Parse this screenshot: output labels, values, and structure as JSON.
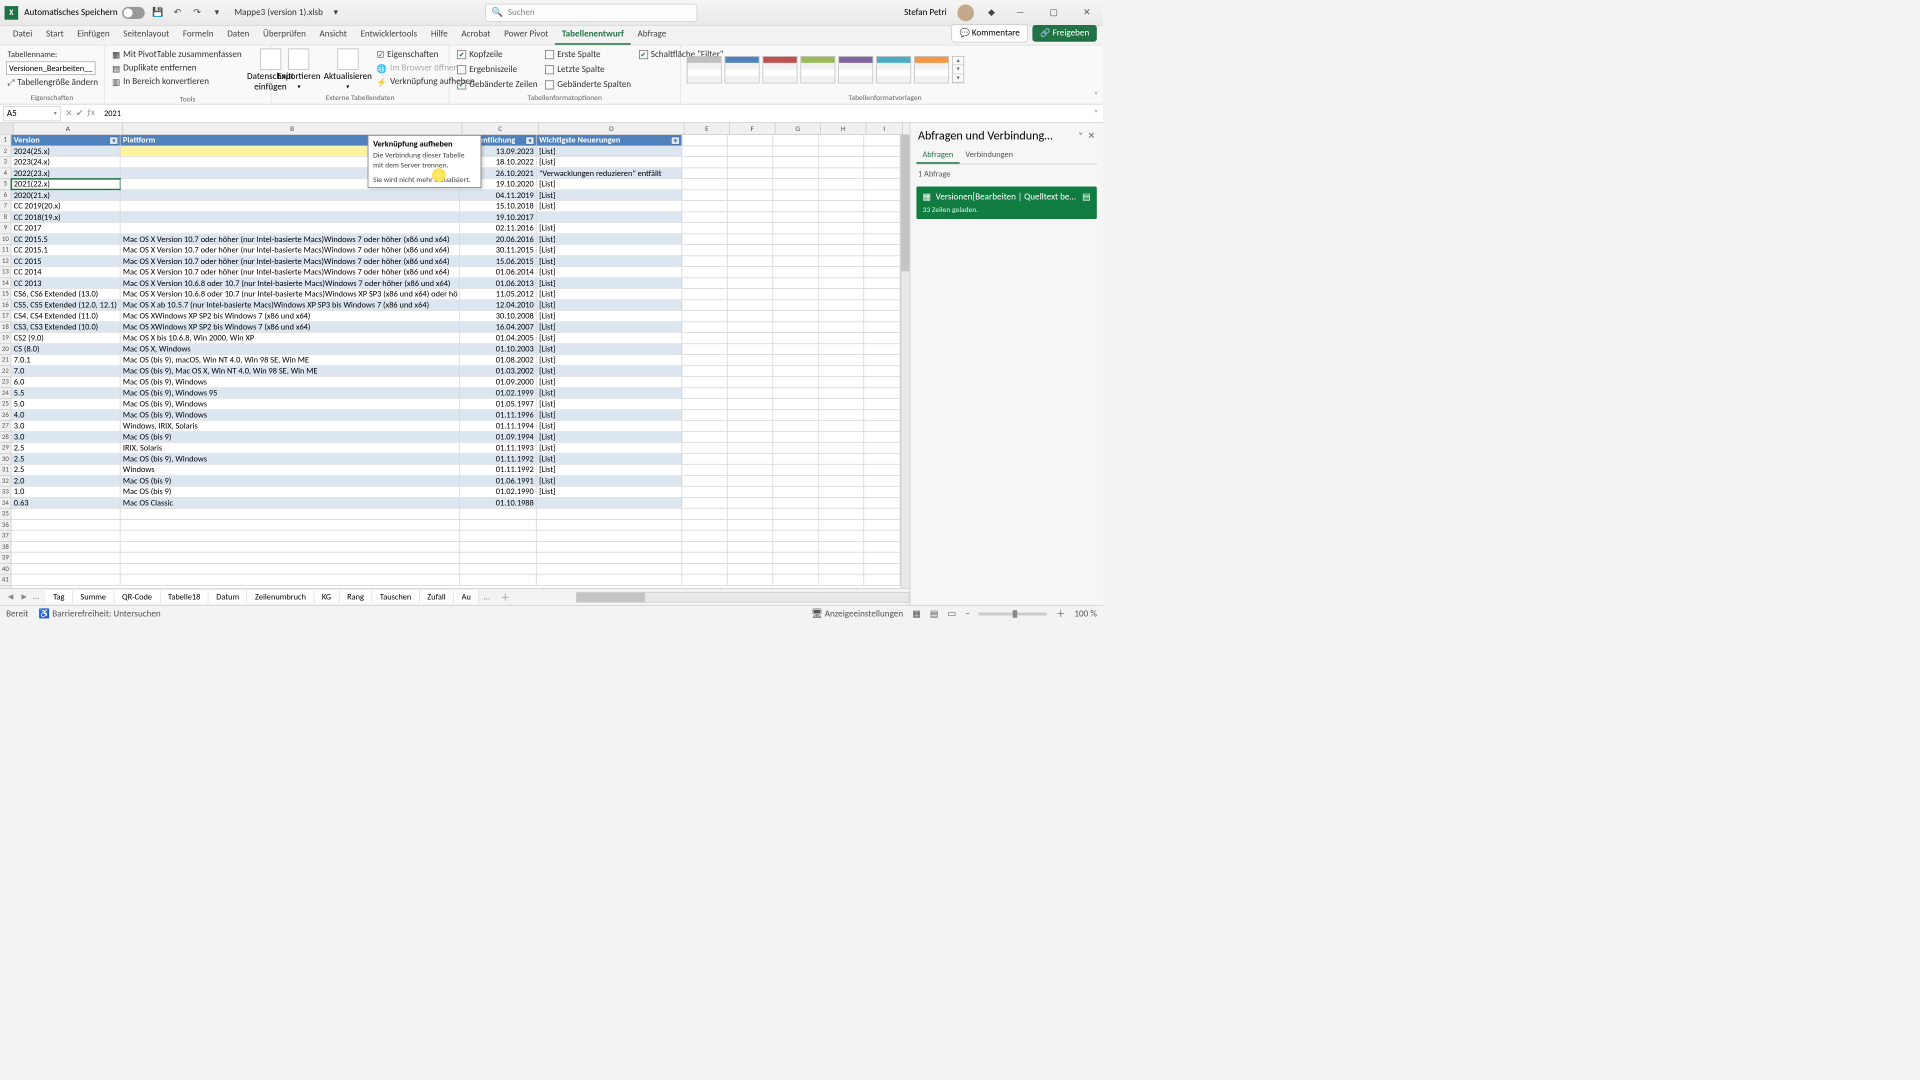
{
  "titlebar": {
    "autosave": "Automatisches Speichern",
    "filename": "Mappe3 (version 1).xlsb",
    "search_ph": "Suchen",
    "user": "Stefan Petri"
  },
  "tabs": [
    "Datei",
    "Start",
    "Einfügen",
    "Seitenlayout",
    "Formeln",
    "Daten",
    "Überprüfen",
    "Ansicht",
    "Entwicklertools",
    "Hilfe",
    "Acrobat",
    "Power Pivot",
    "Tabellenentwurf",
    "Abfrage"
  ],
  "tabs_active": 12,
  "ribbon": {
    "comments": "Kommentare",
    "share": "Freigeben",
    "g_props": {
      "label": "Eigenschaften",
      "name": "Tabellenname:",
      "value": "Versionen_Bearbeiten__Qu",
      "resize": "Tabellengröße ändern"
    },
    "g_tools": {
      "label": "Tools",
      "pivot": "Mit PivotTable zusammenfassen",
      "dup": "Duplikate entfernen",
      "range": "In Bereich konvertieren",
      "slicer": "Datenschnitt\neinfügen"
    },
    "g_ext": {
      "label": "Externe Tabellendaten",
      "export": "Exportieren",
      "refresh": "Aktualisieren",
      "props": "Eigenschaften",
      "browser": "Im Browser öffnen",
      "unlink": "Verknüpfung aufheben"
    },
    "g_opts": {
      "label": "Tabellenformatoptionen",
      "header": "Kopfzeile",
      "total": "Ergebniszeile",
      "banded_r": "Gebänderte Zeilen",
      "first": "Erste Spalte",
      "last": "Letzte Spalte",
      "banded_c": "Gebänderte Spalten",
      "filter": "Schaltfläche \"Filter\""
    },
    "g_styles": {
      "label": "Tabellenformatvorlagen"
    }
  },
  "tooltip": {
    "title": "Verknüpfung aufheben",
    "body": "Die Verbindung dieser Tabelle mit dem Server trennen.",
    "foot": "Sie wird nicht mehr aktualisiert."
  },
  "namebox": "A5",
  "formula": "2021",
  "col_letters": [
    "A",
    "B",
    "C",
    "D",
    "E",
    "F",
    "G",
    "H",
    "I"
  ],
  "headers": {
    "A": "Version",
    "B": "Plattform",
    "C": "eröffentlichung",
    "D": "Wichtigste Neuerungen"
  },
  "rows": [
    {
      "A": "2024(25.x)",
      "B": "",
      "C": "13.09.2023",
      "D": "[List]"
    },
    {
      "A": "2023(24.x)",
      "B": "",
      "C": "18.10.2022",
      "D": "[List]"
    },
    {
      "A": "2022(23.x)",
      "B": "",
      "C": "26.10.2021",
      "D": "\"Verwacklungen reduzieren\" entfällt"
    },
    {
      "A": "2021(22.x)",
      "B": "",
      "C": "19.10.2020",
      "D": "[List]"
    },
    {
      "A": "2020(21.x)",
      "B": "",
      "C": "04.11.2019",
      "D": "[List]"
    },
    {
      "A": "CC 2019(20.x)",
      "B": "",
      "C": "15.10.2018",
      "D": "[List]"
    },
    {
      "A": "CC 2018(19.x)",
      "B": "",
      "C": "19.10.2017",
      "D": ""
    },
    {
      "A": "CC 2017",
      "B": "",
      "C": "02.11.2016",
      "D": "[List]"
    },
    {
      "A": "CC 2015.5",
      "B": "Mac OS X Version 10.7 oder höher (nur Intel-basierte Macs)Windows 7 oder höher (x86 und x64)",
      "C": "20.06.2016",
      "D": "[List]"
    },
    {
      "A": "CC 2015.1",
      "B": "Mac OS X Version 10.7 oder höher (nur Intel-basierte Macs)Windows 7 oder höher (x86 und x64)",
      "C": "30.11.2015",
      "D": "[List]"
    },
    {
      "A": "CC 2015",
      "B": "Mac OS X Version 10.7 oder höher (nur Intel-basierte Macs)Windows 7 oder höher (x86 und x64)",
      "C": "15.06.2015",
      "D": "[List]"
    },
    {
      "A": "CC 2014",
      "B": "Mac OS X Version 10.7 oder höher (nur Intel-basierte Macs)Windows 7 oder höher (x86 und x64)",
      "C": "01.06.2014",
      "D": "[List]"
    },
    {
      "A": "CC 2013",
      "B": "Mac OS X Version 10.6.8 oder 10.7 (nur Intel-basierte Macs)Windows 7 oder höher (x86 und x64)",
      "C": "01.06.2013",
      "D": "[List]"
    },
    {
      "A": "CS6, CS6 Extended (13.0)",
      "B": "Mac OS X Version 10.6.8 oder 10.7 (nur Intel-basierte Macs)Windows XP SP3 (x86 und x64) oder hö",
      "C": "11.05.2012",
      "D": "[List]"
    },
    {
      "A": "CS5, CS5 Extended (12.0, 12.1)",
      "B": "Mac OS X ab 10.5.7 (nur Intel-basierte Macs)Windows XP SP3 bis Windows 7 (x86 und x64)",
      "C": "12.04.2010",
      "D": "[List]"
    },
    {
      "A": "CS4, CS4 Extended (11.0)",
      "B": "Mac OS XWindows XP SP2 bis Windows 7 (x86 und x64)",
      "C": "30.10.2008",
      "D": "[List]"
    },
    {
      "A": "CS3, CS3 Extended (10.0)",
      "B": "Mac OS XWindows XP SP2 bis Windows 7 (x86 und x64)",
      "C": "16.04.2007",
      "D": "[List]"
    },
    {
      "A": "CS2 (9.0)",
      "B": "Mac OS X bis 10.6.8, Win 2000, Win XP",
      "C": "01.04.2005",
      "D": "[List]"
    },
    {
      "A": "CS (8.0)",
      "B": "Mac OS X, Windows",
      "C": "01.10.2003",
      "D": "[List]"
    },
    {
      "A": "7.0.1",
      "B": "Mac OS (bis 9), macOS, Win NT 4.0, Win 98 SE, Win ME",
      "C": "01.08.2002",
      "D": "[List]"
    },
    {
      "A": "7.0",
      "B": "Mac OS (bis 9), Mac OS X, Win NT 4.0, Win 98 SE, Win ME",
      "C": "01.03.2002",
      "D": "[List]"
    },
    {
      "A": "6.0",
      "B": "Mac OS (bis 9), Windows",
      "C": "01.09.2000",
      "D": "[List]"
    },
    {
      "A": "5.5",
      "B": "Mac OS (bis 9), Windows 95",
      "C": "01.02.1999",
      "D": "[List]"
    },
    {
      "A": "5.0",
      "B": "Mac OS (bis 9), Windows",
      "C": "01.05.1997",
      "D": "[List]"
    },
    {
      "A": "4.0",
      "B": "Mac OS (bis 9), Windows",
      "C": "01.11.1996",
      "D": "[List]"
    },
    {
      "A": "3.0",
      "B": "Windows, IRIX, Solaris",
      "C": "01.11.1994",
      "D": "[List]"
    },
    {
      "A": "3.0",
      "B": "Mac OS (bis 9)",
      "C": "01.09.1994",
      "D": "[List]"
    },
    {
      "A": "2.5",
      "B": "IRIX, Solaris",
      "C": "01.11.1993",
      "D": "[List]"
    },
    {
      "A": "2.5",
      "B": "Mac OS (bis 9), Windows",
      "C": "01.11.1992",
      "D": "[List]"
    },
    {
      "A": "2.5",
      "B": "Windows",
      "C": "01.11.1992",
      "D": "[List]"
    },
    {
      "A": "2.0",
      "B": "Mac OS (bis 9)",
      "C": "01.06.1991",
      "D": "[List]"
    },
    {
      "A": "1.0",
      "B": "Mac OS (bis 9)",
      "C": "01.02.1990",
      "D": "[List]"
    },
    {
      "A": "0.63",
      "B": "Mac OS Classic",
      "C": "01.10.1988",
      "D": ""
    }
  ],
  "sel_row": 3,
  "sheets": [
    "Tag",
    "Summe",
    "QR-Code",
    "Tabelle18",
    "Datum",
    "Zeilenumbruch",
    "KG",
    "Rang",
    "Tauschen",
    "Zufall",
    "Au"
  ],
  "status": {
    "ready": "Bereit",
    "access": "Barrierefreiheit: Untersuchen",
    "disp": "Anzeigeeinstellungen",
    "zoom": "100 %"
  },
  "pane": {
    "title": "Abfragen und Verbindung…",
    "tabs": [
      "Abfragen",
      "Verbindungen"
    ],
    "count": "1 Abfrage",
    "qname": "Versionen[Bearbeiten | Quelltext be…",
    "qstat": "33 Zeilen geladen."
  }
}
